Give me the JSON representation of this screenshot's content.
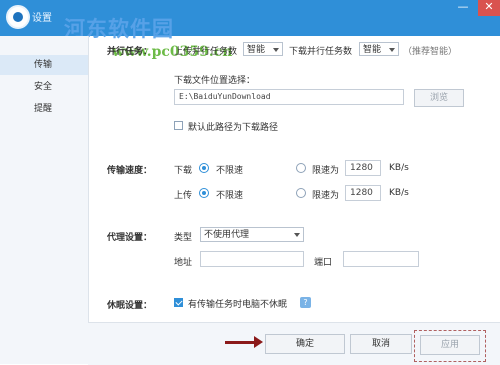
{
  "window": {
    "title": "设置",
    "min_glyph": "—",
    "close_glyph": "✕"
  },
  "watermark": {
    "site_name": "河东软件园",
    "url": "www.pc0359.cn"
  },
  "sidebar": {
    "items": [
      {
        "label": "传输"
      },
      {
        "label": "安全"
      },
      {
        "label": "提醒"
      }
    ]
  },
  "parallel": {
    "section_label": "并行任务：",
    "upload_label": "上传并行任务数",
    "upload_value": "智能",
    "download_label": "下载并行任务数",
    "download_value": "智能",
    "hint": "（推荐智能）"
  },
  "download_location": {
    "label": "下载文件位置选择：",
    "path": "E:\\BaiduYunDownload",
    "browse_label": "浏览",
    "default_checkbox_label": "默认此路径为下载路径",
    "default_checked": false
  },
  "speed": {
    "section_label": "传输速度：",
    "download_label": "下载",
    "upload_label": "上传",
    "unlimited_label": "不限速",
    "limit_label": "限速为",
    "download_limit_value": "1280",
    "upload_limit_value": "1280",
    "unit": "KB/s",
    "download_mode": "unlimited",
    "upload_mode": "unlimited"
  },
  "proxy": {
    "section_label": "代理设置：",
    "type_label": "类型",
    "type_value": "不使用代理",
    "address_label": "地址",
    "address_value": "",
    "port_label": "端口",
    "port_value": ""
  },
  "sleep": {
    "section_label": "休眠设置：",
    "checkbox_label": "有传输任务时电脑不休眠",
    "checked": true,
    "help_glyph": "?"
  },
  "footer": {
    "ok_label": "确定",
    "cancel_label": "取消",
    "apply_label": "应用"
  },
  "colors": {
    "accent": "#2f8fd8",
    "titlebar": "#2f8fd8",
    "sidebar_bg": "#f3f6fa"
  }
}
